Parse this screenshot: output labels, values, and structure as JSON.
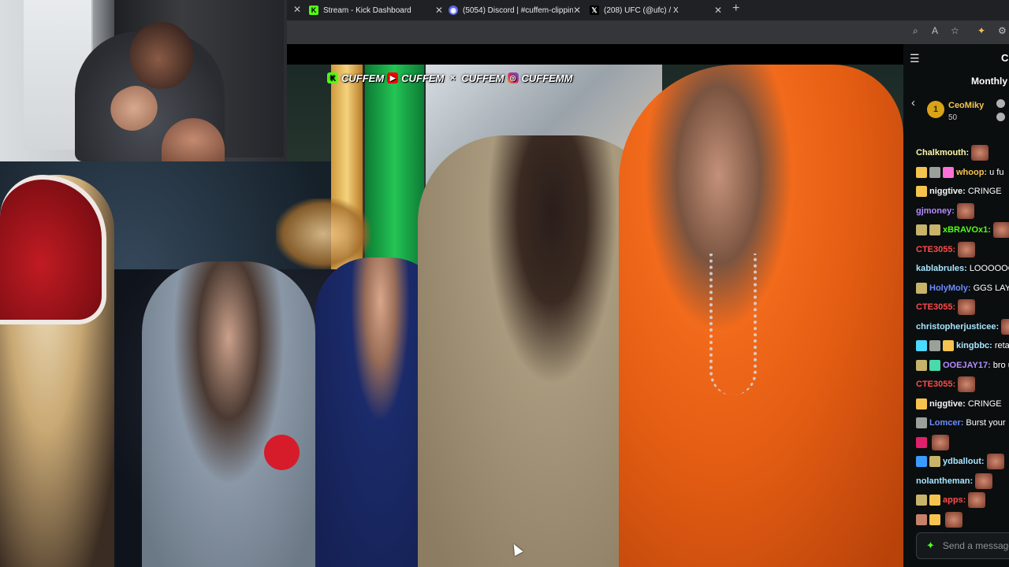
{
  "browser": {
    "tabs": [
      {
        "title": "Stream - Kick Dashboard",
        "favicon": "kick-icon",
        "color": "#53fc18",
        "glyph": "K"
      },
      {
        "title": "(5054) Discord | #cuffem-clipping",
        "favicon": "discord-icon",
        "color": "#5865f2",
        "glyph": "◉"
      },
      {
        "title": "(208) UFC (@ufc) / X",
        "favicon": "x-icon",
        "color": "#000000",
        "glyph": "𝕏"
      }
    ],
    "close_glyph": "✕",
    "new_tab_glyph": "+"
  },
  "watermark": {
    "handles": [
      "CUFFEM",
      "CUFFEM",
      "CUFFEM",
      "CUFFEMM"
    ]
  },
  "chat": {
    "header_title": "C",
    "leaderboard_title": "Monthly",
    "top_gifter": {
      "rank": "1",
      "name": "CeoMiky",
      "amount": "50"
    },
    "messages": [
      {
        "user": "Chalkmouth:",
        "color": "#fff7a8",
        "text": "",
        "badges": [],
        "emote": true
      },
      {
        "user": "whoop:",
        "color": "#f5c44e",
        "text": "u fu",
        "badges": [
          "#f5c44e",
          "#9aa09a",
          "#ff6fd8"
        ],
        "emote": false
      },
      {
        "user": "niggtive:",
        "color": "#f5f5f5",
        "text": "CRINGE",
        "badges": [
          "#f5c44e"
        ],
        "emote": false
      },
      {
        "user": "gjmoney:",
        "color": "#b48cff",
        "text": "",
        "badges": [],
        "emote": true
      },
      {
        "user": "xBRAVOx1:",
        "color": "#53fc18",
        "text": "",
        "badges": [
          "#c7b36a",
          "#c7b36a"
        ],
        "emote": true
      },
      {
        "user": "CTE3055:",
        "color": "#ff4a4a",
        "text": "",
        "badges": [],
        "emote": true
      },
      {
        "user": "kablabrules:",
        "color": "#a8e6ff",
        "text": "LOOOOOO",
        "badges": [],
        "emote": false
      },
      {
        "user": "HolyMoly:",
        "color": "#6c8cff",
        "text": "GGS LAY",
        "badges": [
          "#c7b36a"
        ],
        "emote": false
      },
      {
        "user": "CTE3055:",
        "color": "#ff4a4a",
        "text": "",
        "badges": [],
        "emote": true
      },
      {
        "user": "christopherjusticee:",
        "color": "#a8e6ff",
        "text": "",
        "badges": [],
        "emote": true
      },
      {
        "user": "kingbbc:",
        "color": "#a8e6ff",
        "text": "reta",
        "badges": [
          "#4ad9ff",
          "#9aa09a",
          "#f5c44e"
        ],
        "emote": false
      },
      {
        "user": "OOEJAY17:",
        "color": "#b48cff",
        "text": "bro u",
        "badges": [
          "#c7b36a",
          "#4ad9a8"
        ],
        "emote": false
      },
      {
        "user": "CTE3055:",
        "color": "#ff4a4a",
        "text": "",
        "badges": [],
        "emote": true
      },
      {
        "user": "niggtive:",
        "color": "#f5f5f5",
        "text": "CRINGE",
        "badges": [
          "#f5c44e"
        ],
        "emote": false
      },
      {
        "user": "Lomcer:",
        "color": "#6c8cff",
        "text": "Burst your",
        "badges": [
          "#9aa09a"
        ],
        "emote": false
      },
      {
        "user": "",
        "color": "#ffffff",
        "text": "",
        "badges": [
          "#e0206a"
        ],
        "emote": true
      },
      {
        "user": "ydballout:",
        "color": "#a8e6ff",
        "text": "",
        "badges": [
          "#3a9cff",
          "#c7b36a"
        ],
        "emote": true
      },
      {
        "user": "nolantheman:",
        "color": "#a8e6ff",
        "text": "",
        "badges": [],
        "emote": true
      },
      {
        "user": "apps:",
        "color": "#ff4a4a",
        "text": "",
        "badges": [
          "#c7b36a",
          "#f5c44e"
        ],
        "emote": true
      },
      {
        "user": "",
        "color": "#ffffff",
        "text": "",
        "badges": [
          "#c7806a",
          "#f5c44e"
        ],
        "emote": true
      }
    ],
    "send_placeholder": "Send a message"
  }
}
